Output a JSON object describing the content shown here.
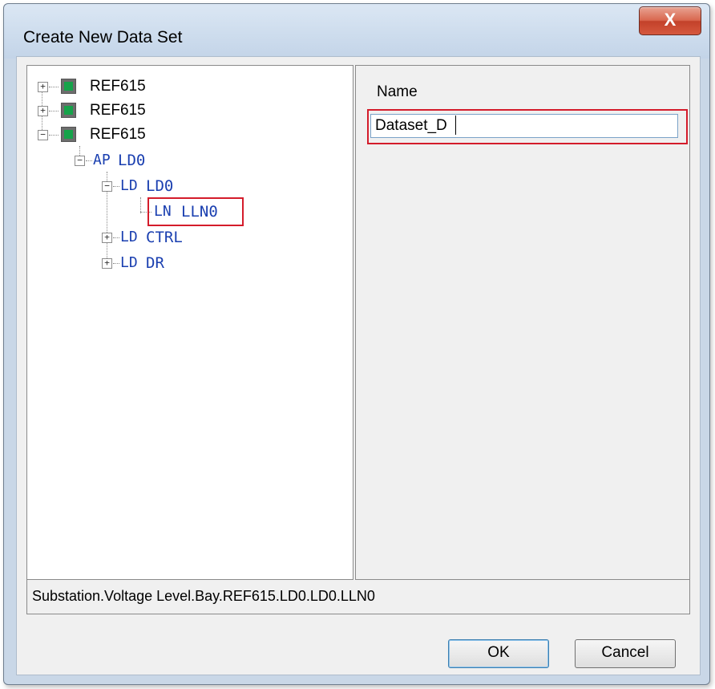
{
  "window": {
    "title": "Create New Data Set",
    "close_glyph": "X"
  },
  "tree": {
    "items": [
      {
        "tag": "",
        "label": "REF615",
        "expander": "+"
      },
      {
        "tag": "",
        "label": "REF615",
        "expander": "+"
      },
      {
        "tag": "",
        "label": "REF615",
        "expander": "−"
      },
      {
        "tag": "AP",
        "label": "LD0",
        "expander": "−"
      },
      {
        "tag": "LD",
        "label": "LD0",
        "expander": "−"
      },
      {
        "tag": "LN",
        "label": "LLN0",
        "expander": ""
      },
      {
        "tag": "LD",
        "label": "CTRL",
        "expander": "+"
      },
      {
        "tag": "LD",
        "label": "DR",
        "expander": "+"
      }
    ]
  },
  "name_panel": {
    "label": "Name",
    "value": "Dataset_D"
  },
  "status": {
    "path": "Substation.Voltage Level.Bay.REF615.LD0.LD0.LLN0"
  },
  "buttons": {
    "ok": "OK",
    "cancel": "Cancel"
  },
  "colors": {
    "highlight": "#d41c2b",
    "tag_blue": "#1a3fb0",
    "device_green": "#16a34a"
  },
  "icons": {
    "device": "device-icon",
    "close": "close-icon"
  }
}
